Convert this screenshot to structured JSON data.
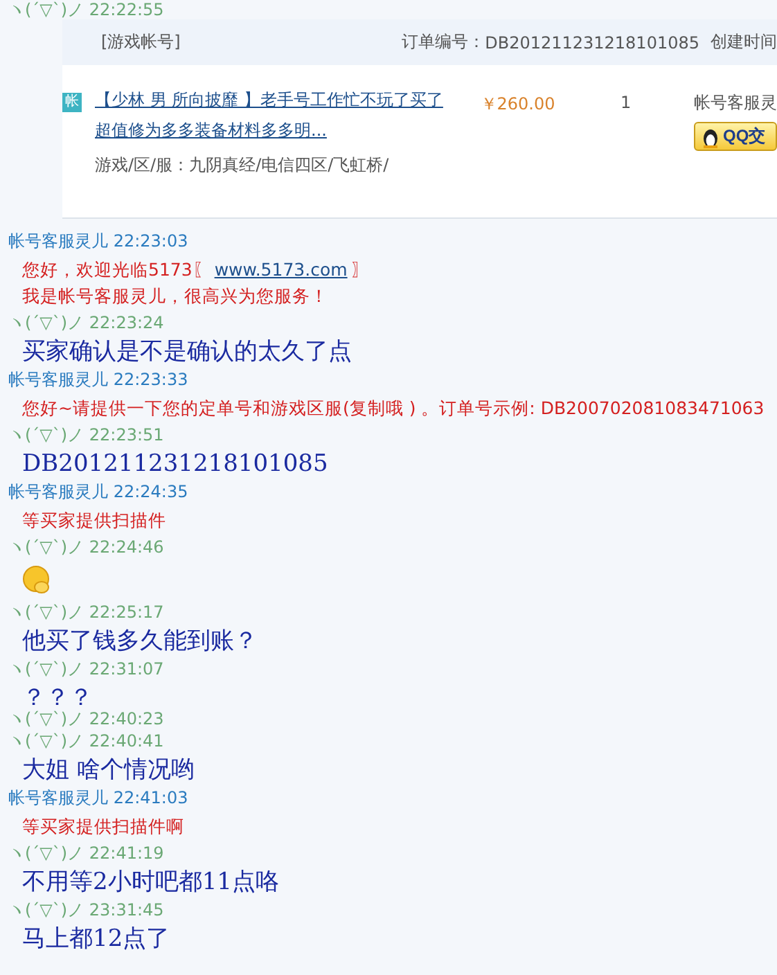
{
  "top_message": {
    "sender": "ヽ(ˊ▽ˋ)ノ",
    "time": "22:22:55"
  },
  "order": {
    "header": {
      "account_label": "[游戏帐号]",
      "order_no_label": "订单编号：",
      "order_no": "DB201211231218101085",
      "created_label": "创建时间"
    },
    "item": {
      "badge": "帐",
      "title": "【少林 男 所向披靡 】老手号工作忙不玩了买了超值修为多多装备材料多多明...",
      "game_label": "游戏/区/服：",
      "game": "九阴真经/电信四区/飞虹桥/",
      "price": "￥260.00",
      "quantity": "1",
      "agent": "帐号客服灵",
      "qq_button": "QQ交"
    }
  },
  "messages": [
    {
      "kind": "agent",
      "sender": "帐号客服灵儿",
      "time": "22:23:03",
      "lines": [
        [
          {
            "kind": "text",
            "text": "您好，欢迎光临5173〖"
          },
          {
            "kind": "link",
            "text": "www.5173.com"
          },
          {
            "kind": "text",
            "text": "〗"
          }
        ],
        "我是帐号客服灵儿，很高兴为您服务！"
      ]
    },
    {
      "kind": "buyer",
      "sender": "ヽ(ˊ▽ˋ)ノ",
      "time": "22:23:24",
      "lines": [
        "买家确认是不是确认的太久了点"
      ]
    },
    {
      "kind": "agent",
      "sender": "帐号客服灵儿",
      "time": "22:23:33",
      "lines": [
        "您好~请提供一下您的定单号和游戏区服(复制哦 ) 。订单号示例: DB200702081083471063"
      ]
    },
    {
      "kind": "buyer",
      "sender": "ヽ(ˊ▽ˋ)ノ",
      "time": "22:23:51",
      "lines": [
        "DB201211231218101085"
      ]
    },
    {
      "kind": "agent",
      "sender": "帐号客服灵儿",
      "time": "22:24:35",
      "lines": [
        "等买家提供扫描件"
      ]
    },
    {
      "kind": "emoji",
      "sender": "ヽ(ˊ▽ˋ)ノ",
      "time": "22:24:46"
    },
    {
      "kind": "buyer",
      "sender": "ヽ(ˊ▽ˋ)ノ",
      "time": "22:25:17",
      "lines": [
        "他买了钱多久能到账？"
      ]
    },
    {
      "kind": "buyer",
      "sender": "ヽ(ˊ▽ˋ)ノ",
      "time": "22:31:07",
      "lines": [
        "？？？"
      ]
    },
    {
      "kind": "stamp",
      "sender": "ヽ(ˊ▽ˋ)ノ",
      "time": "22:40:23"
    },
    {
      "kind": "buyer",
      "sender": "ヽ(ˊ▽ˋ)ノ",
      "time": "22:40:41",
      "lines": [
        "大姐  啥个情况哟"
      ]
    },
    {
      "kind": "agent",
      "sender": "帐号客服灵儿",
      "time": "22:41:03",
      "lines": [
        "等买家提供扫描件啊"
      ]
    },
    {
      "kind": "buyer",
      "sender": "ヽ(ˊ▽ˋ)ノ",
      "time": "22:41:19",
      "lines": [
        "不用等2小时吧都11点咯"
      ]
    },
    {
      "kind": "buyer",
      "sender": "ヽ(ˊ▽ˋ)ノ",
      "time": "23:31:45",
      "lines": [
        "马上都12点了"
      ]
    }
  ]
}
